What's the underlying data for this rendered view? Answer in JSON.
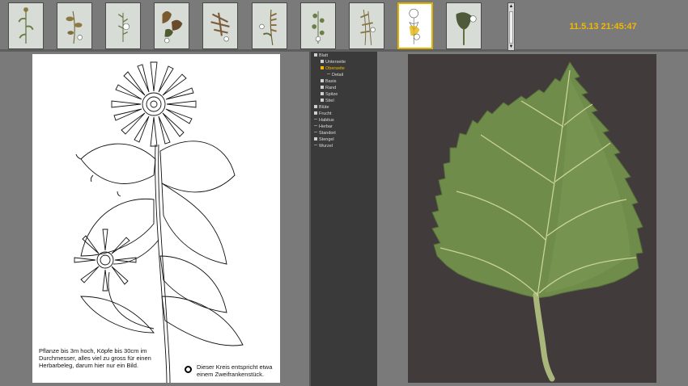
{
  "thumbnails": [
    {
      "name": "thumb-1",
      "selected": false
    },
    {
      "name": "thumb-2",
      "selected": false
    },
    {
      "name": "thumb-3",
      "selected": false
    },
    {
      "name": "thumb-4",
      "selected": false
    },
    {
      "name": "thumb-5",
      "selected": false
    },
    {
      "name": "thumb-6",
      "selected": false
    },
    {
      "name": "thumb-7",
      "selected": false
    },
    {
      "name": "thumb-8",
      "selected": false
    },
    {
      "name": "thumb-9",
      "selected": true
    },
    {
      "name": "thumb-10",
      "selected": false
    }
  ],
  "scroll": {
    "up_icon": "arrow-up-icon",
    "down_icon": "arrow-down-icon"
  },
  "timestamp": "11.5.13 21:45:47",
  "tree": {
    "items": [
      {
        "label": "Blatt",
        "icon": "tree-box",
        "indent": 0,
        "active": false
      },
      {
        "label": "Unterseite",
        "icon": "tree-box",
        "indent": 1,
        "active": false
      },
      {
        "label": "Oberseite",
        "icon": "tree-box",
        "indent": 1,
        "active": true
      },
      {
        "label": "Detail",
        "icon": "tree-line",
        "indent": 2,
        "active": false
      },
      {
        "label": "Basis",
        "icon": "tree-box",
        "indent": 1,
        "active": false
      },
      {
        "label": "Rand",
        "icon": "tree-box",
        "indent": 1,
        "active": false
      },
      {
        "label": "Spitze",
        "icon": "tree-box",
        "indent": 1,
        "active": false
      },
      {
        "label": "Stiel",
        "icon": "tree-box",
        "indent": 1,
        "active": false
      },
      {
        "label": "Blüte",
        "icon": "tree-box",
        "indent": 0,
        "active": false
      },
      {
        "label": "Frucht",
        "icon": "tree-box",
        "indent": 0,
        "active": false
      },
      {
        "label": "Habitus",
        "icon": "tree-line",
        "indent": 0,
        "active": false
      },
      {
        "label": "Herbar",
        "icon": "tree-line",
        "indent": 0,
        "active": false
      },
      {
        "label": "Standort",
        "icon": "tree-line",
        "indent": 0,
        "active": false
      },
      {
        "label": "Stengel",
        "icon": "tree-box",
        "indent": 0,
        "active": false
      },
      {
        "label": "Wurzel",
        "icon": "tree-line",
        "indent": 0,
        "active": false
      }
    ]
  },
  "drawing": {
    "caption_left": "Pflanze bis 3m hoch, Köpfe bis 30cm im Durchmesser, alles viel zu gross für einen Herbarbeleg, darum hier nur ein Bild.",
    "caption_right": "Dieser Kreis entspricht etwa einem Zweifrankenstück.",
    "circle_icon": "circle-outline-icon"
  },
  "photo": {
    "subject": "leaf-photo"
  },
  "colors": {
    "accent": "#f2b800",
    "tree_bg": "#3a3a3a",
    "panel_bg": "#7a7a7a",
    "leaf": "#6f8c4a",
    "photo_bg": "#413b3b"
  }
}
